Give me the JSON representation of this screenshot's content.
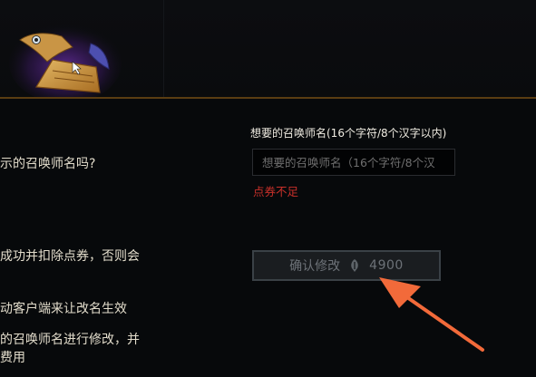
{
  "left_lines": [
    "示的召唤师名吗?",
    "成功并扣除点券，否则会",
    "动客户端来让改名生效",
    "的召唤师名进行修改，并",
    "费用"
  ],
  "form": {
    "label": "想要的召唤师名(16个字符/8个汉字以内)",
    "input_placeholder": "想要的召唤师名（16个字符/8个汉",
    "input_value": "",
    "error": "点券不足"
  },
  "confirm_button": {
    "label": "确认修改",
    "price": "4900",
    "icon": "riot-points-icon"
  },
  "colors": {
    "background": "#07090b",
    "gold_rule": "#5a3d12",
    "error": "#c8302a",
    "arrow": "#f26a3a"
  }
}
